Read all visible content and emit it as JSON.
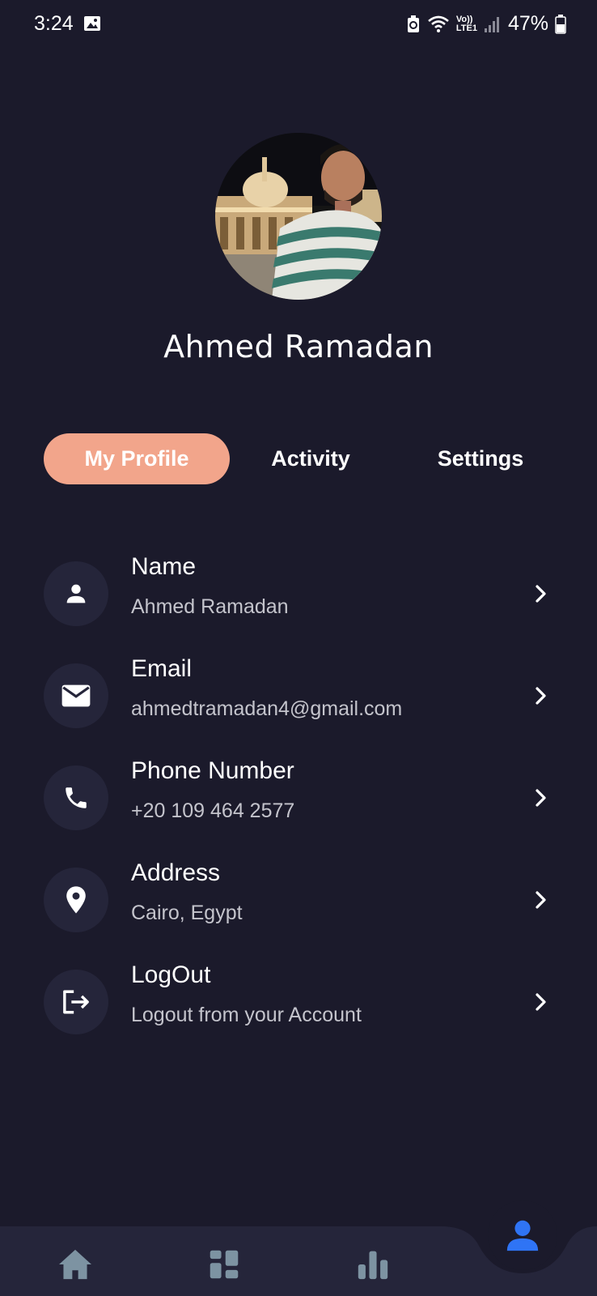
{
  "status_bar": {
    "time": "3:24",
    "battery_percent": "47%",
    "network_label_top": "Vo))",
    "network_label_bottom": "LTE1"
  },
  "profile": {
    "name": "Ahmed Ramadan"
  },
  "tabs": [
    {
      "label": "My Profile",
      "active": true
    },
    {
      "label": "Activity",
      "active": false
    },
    {
      "label": "Settings",
      "active": false
    }
  ],
  "items": [
    {
      "title": "Name",
      "subtitle": "Ahmed Ramadan",
      "icon": "person-icon"
    },
    {
      "title": "Email",
      "subtitle": "ahmedtramadan4@gmail.com",
      "icon": "mail-icon"
    },
    {
      "title": "Phone Number",
      "subtitle": "+20 109 464 2577",
      "icon": "phone-icon"
    },
    {
      "title": "Address",
      "subtitle": "Cairo, Egypt",
      "icon": "location-pin-icon"
    },
    {
      "title": "LogOut",
      "subtitle": "Logout from your Account",
      "icon": "logout-icon"
    }
  ],
  "bottom_nav": {
    "items": [
      "home-icon",
      "dashboard-icon",
      "bar-chart-icon",
      "profile-icon"
    ],
    "active": "profile-icon"
  },
  "colors": {
    "background": "#1b1a2b",
    "accent_tab": "#f2a58b",
    "icon_circle": "#25253a",
    "nav_bar": "#25253a",
    "nav_icon": "#7d93a2",
    "nav_active": "#2f74f5"
  }
}
